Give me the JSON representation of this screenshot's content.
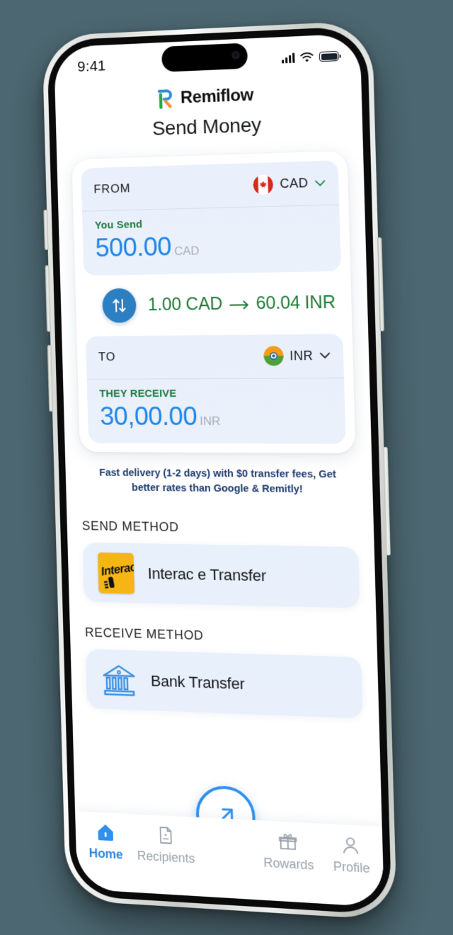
{
  "status_bar": {
    "time": "9:41",
    "icons": [
      "signal-icon",
      "wifi-icon",
      "battery-icon"
    ]
  },
  "brand": {
    "name": "Remiflow",
    "logo": "remiflow-logo-icon"
  },
  "header": {
    "title": "Send Money"
  },
  "converter": {
    "from": {
      "label": "FROM",
      "currency_code": "CAD",
      "flag": "canada-flag-icon",
      "amount_label": "You Send",
      "amount": "500.00",
      "amount_currency": "CAD"
    },
    "rate": {
      "swap_icon": "swap-vertical-icon",
      "text": "1.00 CAD → 60.04 INR",
      "base": "1.00 CAD",
      "quote": "60.04 INR"
    },
    "to": {
      "label": "TO",
      "currency_code": "INR",
      "flag": "india-flag-icon",
      "amount_label": "THEY RECEIVE",
      "amount": "30,00.00",
      "amount_currency": "INR"
    }
  },
  "promo": {
    "text": "Fast delivery (1-2 days) with $0 transfer fees, Get better rates than Google & Remitly!"
  },
  "send_method": {
    "section_label": "SEND METHOD",
    "name": "Interac e Transfer",
    "logo_text": "Interac",
    "logo_color": "#f5b515"
  },
  "receive_method": {
    "section_label": "RECEIVE METHOD",
    "name": "Bank Transfer",
    "icon": "bank-icon"
  },
  "fab": {
    "icon": "arrow-up-right-icon"
  },
  "tabbar": {
    "items": [
      {
        "label": "Home",
        "icon": "home-icon",
        "active": true
      },
      {
        "label": "Recipients",
        "icon": "contact-card-icon",
        "active": false
      },
      {
        "label": "Rowards",
        "icon": "gift-icon",
        "active": false
      },
      {
        "label": "Profile",
        "icon": "person-icon",
        "active": false
      }
    ]
  },
  "colors": {
    "background": "#4c6771",
    "accent_blue": "#2f90ee",
    "amount_blue": "#1f86e8",
    "green": "#1f7a35",
    "navy": "#1c3a70",
    "pane_blue": "#e9f0fb"
  }
}
